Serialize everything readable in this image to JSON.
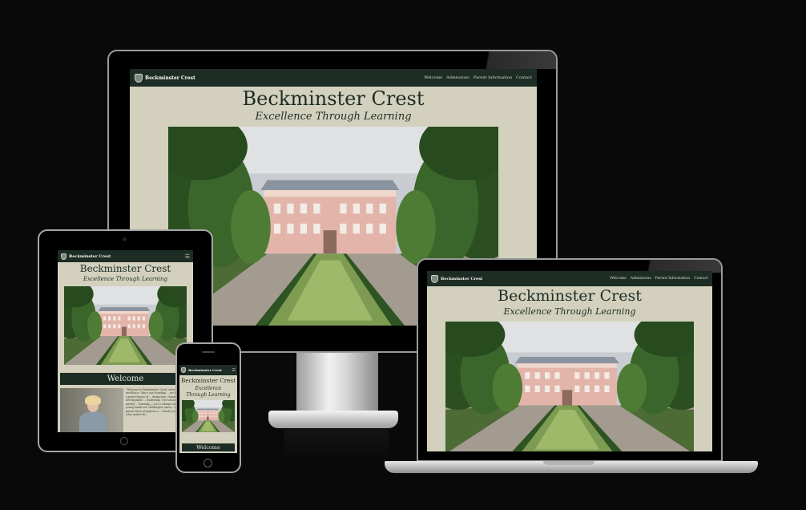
{
  "site": {
    "logo_text": "Beckminster Crest",
    "title": "Beckminster Crest",
    "tagline": "Excellence Through Learning",
    "nav": [
      "Welcome",
      "Admissions",
      "Parent Information",
      "Contact"
    ],
    "menu_icon": "hamburger-menu-icon",
    "welcome_heading": "Welcome",
    "intro_text": "\"Welcome to Beckminster Crest, where ... remote excellence. Since our founding ... we have upheld a proud legacy of ... distinction, character development ... leadership. Our school is not merely ... learning — it is a vibrant communit... young minds are challenged, nurtu... inspired to pursue lives of purpose a... I invite you to explore what makes Be..."
  },
  "devices": [
    "desktop-monitor",
    "tablet",
    "smartphone",
    "laptop"
  ],
  "colors": {
    "background": "#0a0909",
    "nav": "#1d2c24",
    "page": "#d3d1bd",
    "heading": "#1d2c24"
  }
}
